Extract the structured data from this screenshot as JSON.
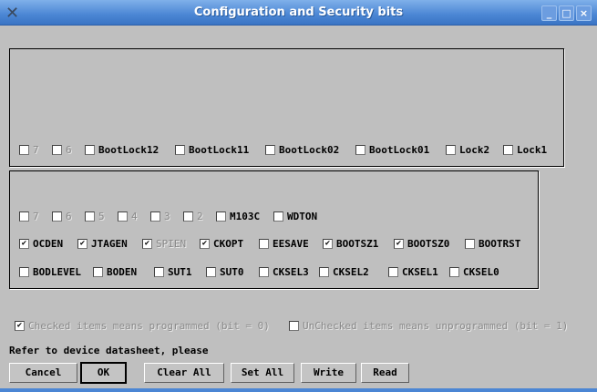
{
  "window": {
    "title": "Configuration and Security bits",
    "app_icon": "x-icon",
    "minimize": "_",
    "maximize": "□",
    "close": "×"
  },
  "lock_bits": [
    {
      "label": "7",
      "checked": false,
      "disabled": true
    },
    {
      "label": "6",
      "checked": false,
      "disabled": true
    },
    {
      "label": "BootLock12",
      "checked": false,
      "disabled": false
    },
    {
      "label": "BootLock11",
      "checked": false,
      "disabled": false
    },
    {
      "label": "BootLock02",
      "checked": false,
      "disabled": false
    },
    {
      "label": "BootLock01",
      "checked": false,
      "disabled": false
    },
    {
      "label": "Lock2",
      "checked": false,
      "disabled": false
    },
    {
      "label": "Lock1",
      "checked": false,
      "disabled": false
    }
  ],
  "fuse_rows": [
    [
      {
        "label": "7",
        "checked": false,
        "disabled": true
      },
      {
        "label": "6",
        "checked": false,
        "disabled": true
      },
      {
        "label": "5",
        "checked": false,
        "disabled": true
      },
      {
        "label": "4",
        "checked": false,
        "disabled": true
      },
      {
        "label": "3",
        "checked": false,
        "disabled": true
      },
      {
        "label": "2",
        "checked": false,
        "disabled": true
      },
      {
        "label": "M103C",
        "checked": false,
        "disabled": false
      },
      {
        "label": "WDTON",
        "checked": false,
        "disabled": false
      }
    ],
    [
      {
        "label": "OCDEN",
        "checked": true,
        "disabled": false
      },
      {
        "label": "JTAGEN",
        "checked": true,
        "disabled": false
      },
      {
        "label": "SPIEN",
        "checked": true,
        "disabled": true
      },
      {
        "label": "CKOPT",
        "checked": true,
        "disabled": false
      },
      {
        "label": "EESAVE",
        "checked": false,
        "disabled": false
      },
      {
        "label": "BOOTSZ1",
        "checked": true,
        "disabled": false
      },
      {
        "label": "BOOTSZ0",
        "checked": true,
        "disabled": false
      },
      {
        "label": "BOOTRST",
        "checked": false,
        "disabled": false
      }
    ],
    [
      {
        "label": "BODLEVEL",
        "checked": false,
        "disabled": false
      },
      {
        "label": "BODEN",
        "checked": false,
        "disabled": false
      },
      {
        "label": "SUT1",
        "checked": false,
        "disabled": false
      },
      {
        "label": "SUT0",
        "checked": false,
        "disabled": false
      },
      {
        "label": "CKSEL3",
        "checked": false,
        "disabled": false
      },
      {
        "label": "CKSEL2",
        "checked": false,
        "disabled": false
      },
      {
        "label": "CKSEL1",
        "checked": false,
        "disabled": false
      },
      {
        "label": "CKSEL0",
        "checked": false,
        "disabled": false
      }
    ]
  ],
  "legend": {
    "checked_text": "Checked items means programmed (bit = 0)",
    "checked": true,
    "unchecked_text": "UnChecked items means unprogrammed (bit = 1)",
    "unchecked": false
  },
  "info": "Refer to device datasheet, please",
  "buttons": {
    "cancel": "Cancel",
    "ok": "OK",
    "clear_all": "Clear All",
    "set_all": "Set All",
    "write": "Write",
    "read": "Read"
  }
}
